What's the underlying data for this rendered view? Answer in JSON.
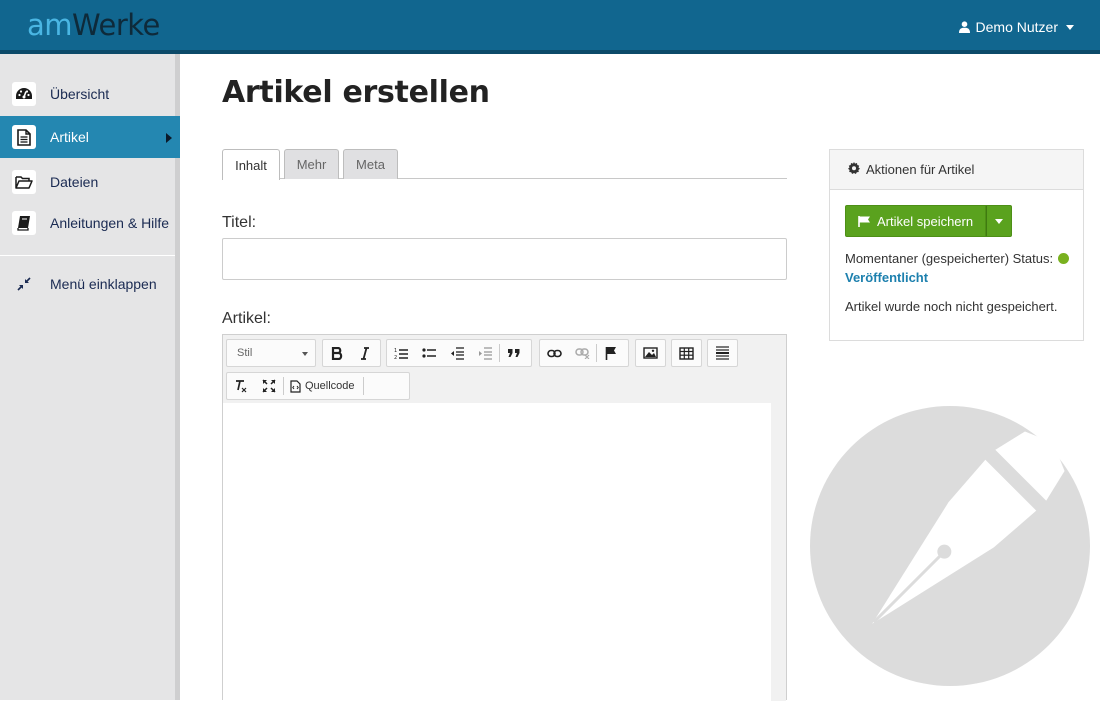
{
  "header": {
    "logo_am": "am",
    "logo_werke": "Werke",
    "user_name": "Demo Nutzer"
  },
  "sidebar": {
    "items": [
      {
        "label": "Übersicht",
        "icon": "dashboard-icon"
      },
      {
        "label": "Artikel",
        "icon": "document-icon",
        "active": true
      },
      {
        "label": "Dateien",
        "icon": "folder-open-icon"
      },
      {
        "label": "Anleitungen & Hilfe",
        "icon": "book-icon"
      }
    ],
    "collapse_label": "Menü einklappen"
  },
  "main": {
    "title": "Artikel erstellen",
    "tabs": [
      {
        "label": "Inhalt",
        "active": true
      },
      {
        "label": "Mehr",
        "active": false
      },
      {
        "label": "Meta",
        "active": false
      }
    ],
    "title_label": "Titel:",
    "title_value": "",
    "article_label": "Artikel:"
  },
  "editor": {
    "style_select": "Stil",
    "source_label": "Quellcode"
  },
  "panel": {
    "heading": "Aktionen für Artikel",
    "save_label": "Artikel speichern",
    "status_text": "Momentaner (gespeicherter) Status:",
    "status_value": "Veröffentlicht",
    "status_color": "#79b11f",
    "note": "Artikel wurde noch nicht gespeichert."
  },
  "colors": {
    "topbar": "#11668f",
    "active_nav": "#2487b1",
    "save_button": "#5aa21e",
    "link": "#1d80ae"
  }
}
